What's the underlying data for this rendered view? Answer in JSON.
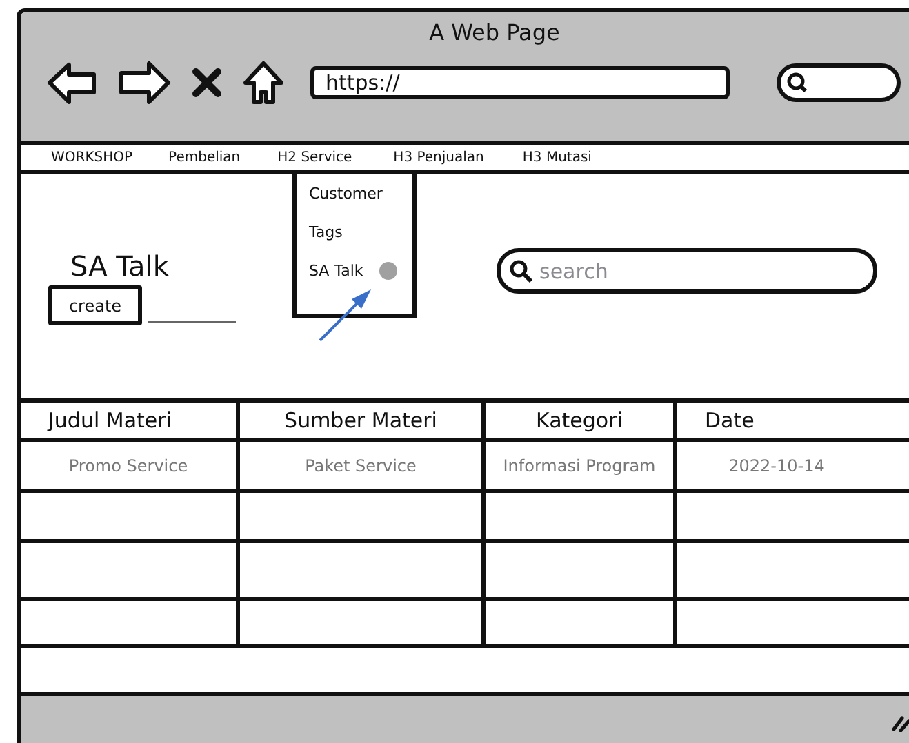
{
  "window": {
    "title": "A Web Page"
  },
  "address_bar": {
    "value": "https://"
  },
  "nav": [
    "WORKSHOP",
    "Pembelian",
    "H2 Service",
    "H3 Penjualan",
    "H3 Mutasi"
  ],
  "dropdown": [
    {
      "label": "Customer",
      "selected": false
    },
    {
      "label": "Tags",
      "selected": false
    },
    {
      "label": "SA Talk",
      "selected": true
    }
  ],
  "page": {
    "heading": "SA Talk",
    "create_button": "create"
  },
  "search": {
    "placeholder": "search"
  },
  "table": {
    "columns": [
      "Judul Materi",
      "Sumber Materi",
      "Kategori",
      "Date"
    ],
    "rows": [
      [
        "Promo Service",
        "Paket Service",
        "Informasi Program",
        "2022-10-14"
      ]
    ]
  }
}
